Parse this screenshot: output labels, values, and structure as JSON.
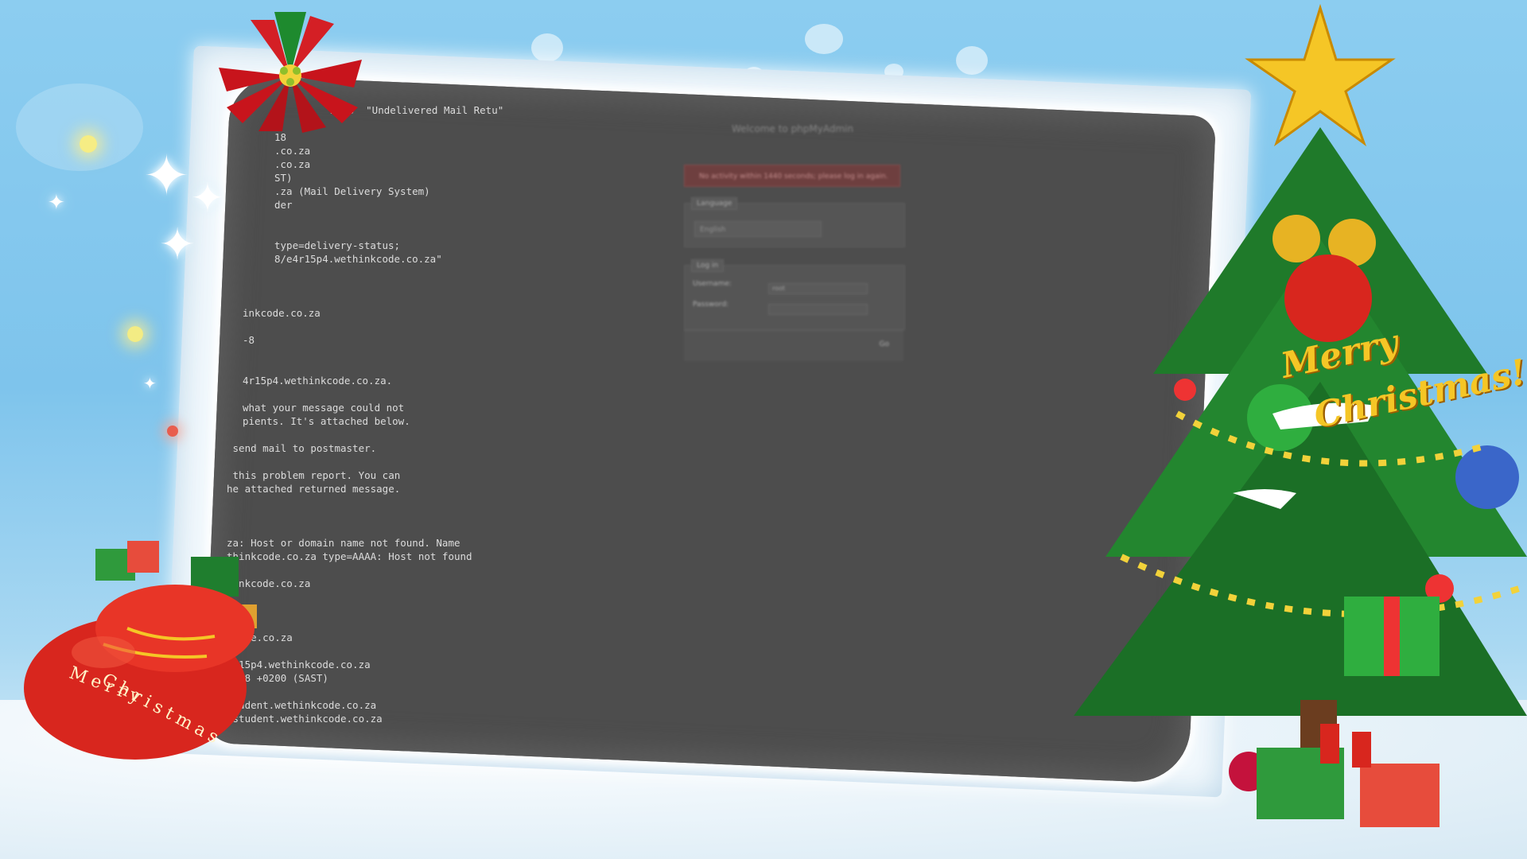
{
  "mail_window": {
    "lines": [
      "2523  \"Undelivered Mail Retu\"",
      "",
      "18",
      ".co.za",
      ".co.za",
      "ST)",
      ".za (Mail Delivery System)",
      "der",
      "",
      "",
      "type=delivery-status;",
      "8/e4r15p4.wethinkcode.co.za\"",
      "",
      "",
      "",
      "inkcode.co.za",
      "",
      "-8",
      "",
      "",
      "4r15p4.wethinkcode.co.za.",
      "",
      "what your message could not",
      "pients. It's attached below.",
      "",
      " send mail to postmaster.",
      "",
      " this problem report. You can",
      "he attached returned message.",
      "",
      "",
      "",
      "za: Host or domain name not found. Name",
      "thinkcode.co.za type=AAAA: Host not found",
      "",
      "hinkcode.co.za",
      "",
      "",
      "",
      "kcode.co.za",
      "",
      "4r15p4.wethinkcode.co.za",
      "2:48 +0200 (SAST)",
      "",
      "student.wethinkcode.co.za",
      "@student.wethinkcode.co.za"
    ]
  },
  "phpmyadmin": {
    "title": "Welcome to phpMyAdmin",
    "error": "No activity within 1440 seconds; please log in again.",
    "language_legend": "Language",
    "language_value": "English",
    "login_legend": "Log in",
    "username_label": "Username:",
    "username_value": "root",
    "password_label": "Password:",
    "go_label": "Go"
  },
  "decorations": {
    "bag_text_line1": "Merry",
    "bag_text_line2": "Christmas",
    "tree_text_line1": "Merry",
    "tree_text_line2": "Christmas!",
    "icons": [
      "poinsettia-icon",
      "star-icon",
      "christmas-tree-icon",
      "gift-bag-icon",
      "bell-icon",
      "ornament-icon"
    ]
  },
  "colors": {
    "sky": "#7ec4ec",
    "screen": "#4d4d4d",
    "tree_green": "#1f7a2a",
    "bag_red": "#d8261e",
    "gold": "#f5c626"
  }
}
